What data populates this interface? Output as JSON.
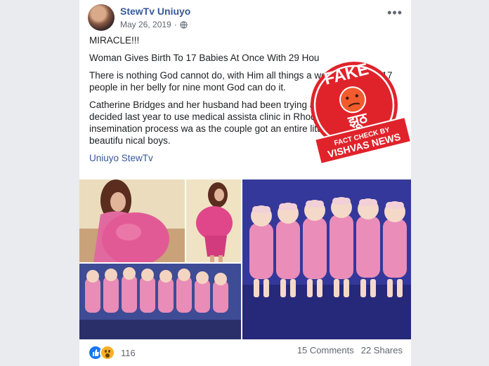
{
  "post": {
    "author": "StewTv Uniuyo",
    "date": "May 26, 2019",
    "audience_icon": "globe-icon",
    "more_icon": "more-options-icon",
    "paragraphs": [
      "MIRACLE!!!",
      "Woman Gives Birth To 17 Babies At Once With 29 Hou",
      "There is nothing God cannot do, with Him all things a woman to carry 17 people in her belly for nine mont God can do it.",
      "Catherine Bridges and her husband had been trying a ny years and had decided last year to use medical assista clinic in Rhodes Island. The insemination process wa as the couple got an entire litter of seventeen beautifu nical boys."
    ],
    "page_link": "Uniuyo StewTv",
    "reactions_count": "116",
    "comments": "15 Comments",
    "shares": "22 Shares"
  },
  "stamp": {
    "top_text": "FAKE",
    "hindi_text": "झूठ",
    "band_top": "FACT CHECK BY",
    "band_bottom": "VISHVAS NEWS",
    "color": "#e0232b"
  },
  "colors": {
    "link": "#385898",
    "pink": "#e06aa0"
  }
}
